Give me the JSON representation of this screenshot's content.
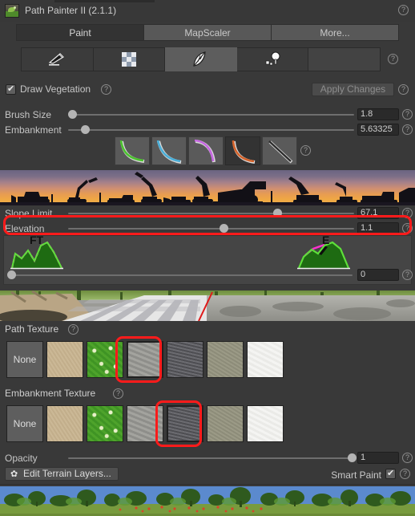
{
  "window": {
    "title": "Path Painter II (2.1.1)",
    "app_icon": "path-painter-logo",
    "help_glyph": "?"
  },
  "tabs": [
    {
      "label": "Paint",
      "active": true
    },
    {
      "label": "MapScaler",
      "active": false
    },
    {
      "label": "More...",
      "active": false
    }
  ],
  "toolbar": {
    "tools": [
      {
        "name": "scraper-tool",
        "selected": false
      },
      {
        "name": "checker-tool",
        "selected": false
      },
      {
        "name": "feather-tool",
        "selected": true
      },
      {
        "name": "object-tool",
        "selected": false
      },
      {
        "name": "empty-slot",
        "selected": false
      }
    ]
  },
  "vegetation": {
    "label": "Draw Vegetation",
    "checked": true,
    "apply_label": "Apply Changes"
  },
  "brush": {
    "size_label": "Brush Size",
    "size_value": "1.8",
    "size_fill_pct": 2,
    "embankment_label": "Embankment",
    "embankment_value": "5.63325",
    "embankment_fill_pct": 8
  },
  "curves": [
    {
      "name": "curve-green",
      "color": "#4cc22f",
      "selected": false
    },
    {
      "name": "curve-blue",
      "color": "#4aaed8",
      "selected": false
    },
    {
      "name": "curve-purple",
      "color": "#c768e2",
      "selected": false
    },
    {
      "name": "curve-orange",
      "color": "#d4622a",
      "selected": true
    },
    {
      "name": "curve-linear",
      "color": "#2c2c2c",
      "selected": false
    }
  ],
  "banner_top": {
    "name": "construction-equipment-sunset-banner"
  },
  "terrain": {
    "slope_label": "Slope Limit",
    "slope_value": "67.1",
    "slope_fill_pct": 68,
    "elevation_label": "Elevation",
    "elevation_value": "1.1",
    "elevation_fill_pct": 54,
    "falloff_value": "0",
    "falloff_fill_pct": 0,
    "graph_left_label": "FT",
    "graph_right_label": "E"
  },
  "banner_road": {
    "name": "road-terrain-preview"
  },
  "path_texture": {
    "label": "Path Texture",
    "swatches": [
      {
        "name": "texture-none",
        "label": "None",
        "kind": "none",
        "selected": false
      },
      {
        "name": "texture-sand",
        "label": "",
        "kind": "sand",
        "selected": false
      },
      {
        "name": "texture-grass",
        "label": "",
        "kind": "grass",
        "selected": false
      },
      {
        "name": "texture-rock",
        "label": "",
        "kind": "rock",
        "selected": true
      },
      {
        "name": "texture-gravel",
        "label": "",
        "kind": "gravel",
        "selected": false
      },
      {
        "name": "texture-olive",
        "label": "",
        "kind": "olive",
        "selected": false
      },
      {
        "name": "texture-white",
        "label": "",
        "kind": "white",
        "selected": false
      }
    ]
  },
  "embankment_texture": {
    "label": "Embankment Texture",
    "swatches": [
      {
        "name": "texture-none",
        "label": "None",
        "kind": "none",
        "selected": false
      },
      {
        "name": "texture-sand",
        "label": "",
        "kind": "sand",
        "selected": false
      },
      {
        "name": "texture-grass",
        "label": "",
        "kind": "grass",
        "selected": false
      },
      {
        "name": "texture-rock",
        "label": "",
        "kind": "rock",
        "selected": false
      },
      {
        "name": "texture-gravel",
        "label": "",
        "kind": "gravel",
        "selected": true
      },
      {
        "name": "texture-olive",
        "label": "",
        "kind": "olive",
        "selected": false
      },
      {
        "name": "texture-white",
        "label": "",
        "kind": "white",
        "selected": false
      }
    ]
  },
  "opacity": {
    "label": "Opacity",
    "value": "1",
    "fill_pct": 100
  },
  "footer": {
    "edit_layers_label": "Edit Terrain Layers...",
    "gear_glyph": "✿",
    "smart_paint_label": "Smart Paint",
    "smart_paint_checked": true
  },
  "banner_bottom": {
    "name": "tree-meadow-preview"
  },
  "annotations": {
    "accent_color": "#ff1b1b",
    "highlights": [
      "elevation-row-highlight",
      "path-texture-rock-highlight",
      "embankment-texture-gravel-highlight"
    ]
  }
}
